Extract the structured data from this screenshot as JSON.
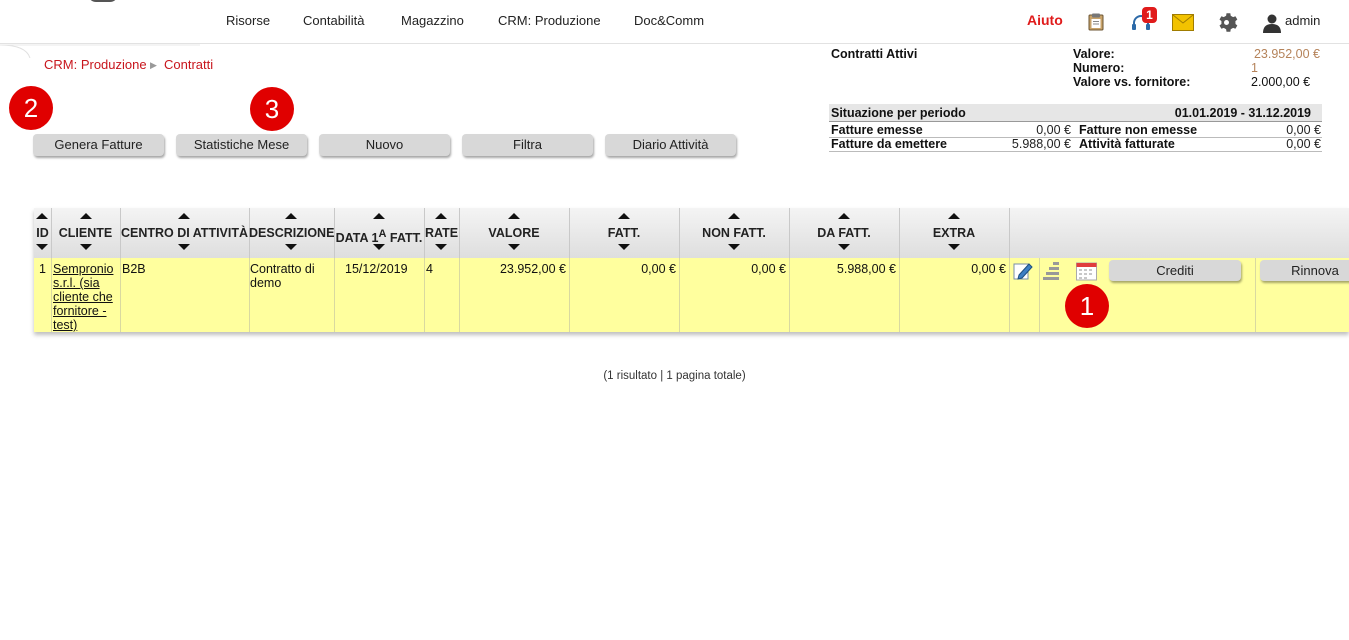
{
  "nav": {
    "items": [
      "Risorse",
      "Contabilità",
      "Magazzino",
      "CRM: Produzione",
      "Doc&Comm"
    ],
    "help": "Aiuto",
    "notification_count": "1",
    "user": "admin",
    "icons": [
      "clipboard-icon",
      "headset-icon",
      "mail-icon",
      "gear-icon",
      "user-icon"
    ]
  },
  "breadcrumb": {
    "parent": "CRM: Produzione",
    "current": "Contratti"
  },
  "markers": [
    "1",
    "2",
    "3"
  ],
  "actions": [
    "Genera Fatture",
    "Statistiche Mese",
    "Nuovo",
    "Filtra",
    "Diario Attività"
  ],
  "summary": {
    "title": "Contratti Attivi",
    "valore_label": "Valore:",
    "valore": "23.952,00 €",
    "numero_label": "Numero:",
    "numero": "1",
    "fornitore_label": "Valore vs. fornitore:",
    "fornitore": "2.000,00 €",
    "period_label": "Situazione per periodo",
    "period": "01.01.2019 - 31.12.2019",
    "emesse_label": "Fatture emesse",
    "emesse": "0,00 €",
    "non_emesse_label": "Fatture non emesse",
    "non_emesse": "0,00 €",
    "da_emettere_label": "Fatture da emettere",
    "da_emettere": "5.988,00 €",
    "att_fatturate_label": "Attività fatturate",
    "att_fatturate": "0,00 €",
    "accent_color": "#b5835a"
  },
  "table": {
    "headers": [
      "ID",
      "CLIENTE",
      "CENTRO DI ATTIVITÀ",
      "DESCRIZIONE",
      "DATA 1",
      "A",
      "FATT.",
      "RATE",
      "VALORE",
      "FATT.",
      "NON FATT.",
      "DA FATT.",
      "EXTRA"
    ],
    "row": {
      "id": "1",
      "cliente": [
        "Sempronio",
        "s.r.l. (sia",
        "cliente che",
        "fornitore -",
        "test)"
      ],
      "centro": "B2B",
      "descrizione": [
        "Contratto di",
        "demo"
      ],
      "data": "15/12/2019",
      "rate": "4",
      "valore": "23.952,00 €",
      "fatt": "0,00 €",
      "non_fatt": "0,00 €",
      "da_fatt": "5.988,00 €",
      "extra": "0,00 €",
      "btn_crediti": "Crediti",
      "btn_rinnova": "Rinnova"
    },
    "row_color": "#ffff9e"
  },
  "footer": "(1 risultato | 1 pagina totale)"
}
